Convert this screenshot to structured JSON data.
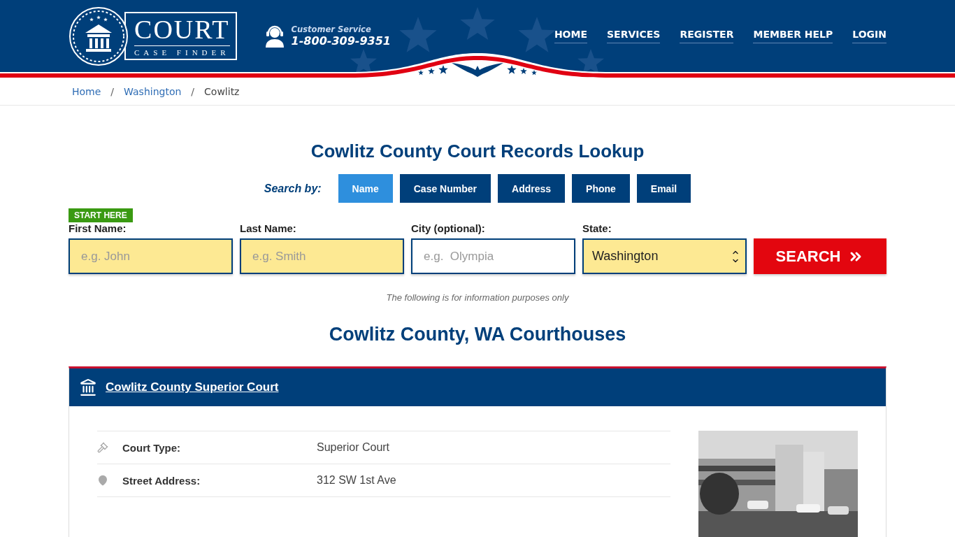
{
  "header": {
    "logo": {
      "title": "COURT",
      "subtitle": "CASE FINDER"
    },
    "customer_service": {
      "label": "Customer Service",
      "phone": "1-800-309-9351"
    },
    "nav": [
      "HOME",
      "SERVICES",
      "REGISTER",
      "MEMBER HELP",
      "LOGIN"
    ]
  },
  "breadcrumb": [
    {
      "label": "Home",
      "link": true
    },
    {
      "separator": "/",
      "label": "Washington",
      "link": true
    },
    {
      "separator": "/",
      "label": "Cowlitz",
      "link": false
    }
  ],
  "title": "Cowlitz County Court Records Lookup",
  "search_by": {
    "label": "Search by:",
    "tabs": [
      {
        "label": "Name",
        "selected": true
      },
      {
        "label": "Case Number",
        "selected": false
      },
      {
        "label": "Address",
        "selected": false
      },
      {
        "label": "Phone",
        "selected": false
      },
      {
        "label": "Email",
        "selected": false
      }
    ]
  },
  "form": {
    "badge": "START HERE",
    "fields": [
      {
        "kind": "input",
        "label": "First Name:",
        "placeholder": "e.g. John",
        "highlighted": true
      },
      {
        "kind": "input",
        "label": "Last Name:",
        "placeholder": "e.g. Smith",
        "highlighted": true
      },
      {
        "kind": "input",
        "label": "City (optional):",
        "placeholder": "e.g.  Olympia",
        "highlighted": false
      },
      {
        "kind": "select",
        "label": "State:",
        "value": "Washington",
        "highlighted": true
      }
    ],
    "button": "SEARCH"
  },
  "disclaimer": "The following is for information purposes only",
  "courthouses_title": "Cowlitz County, WA Courthouses",
  "courthouses": [
    {
      "name": "Cowlitz County Superior Court",
      "details": [
        {
          "kind": "type",
          "label": "Court Type:",
          "value": "Superior Court"
        },
        {
          "kind": "address",
          "label": "Street Address:",
          "value": "312 SW 1st Ave"
        }
      ],
      "photo": {
        "kind": "picture"
      }
    }
  ]
}
